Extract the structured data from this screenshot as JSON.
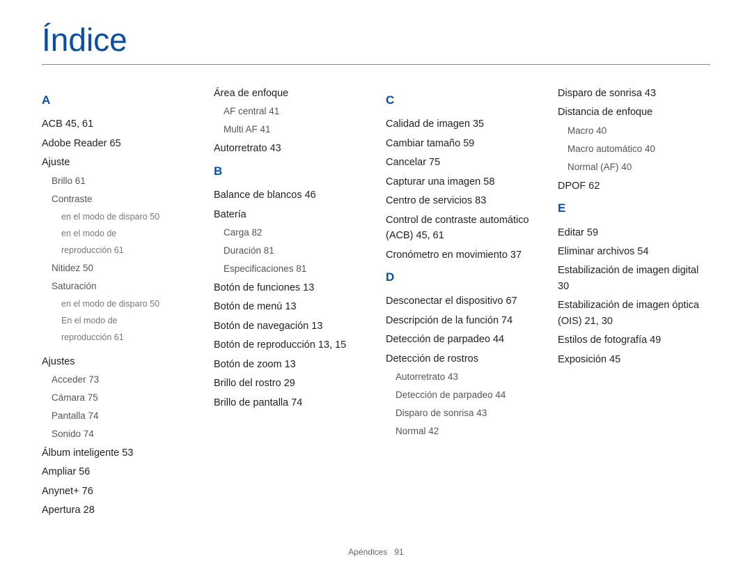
{
  "title": "Índice",
  "footer": {
    "section": "Apéndices",
    "page": "91"
  },
  "columns": [
    {
      "blocks": [
        {
          "type": "letter",
          "text": "A"
        },
        {
          "type": "entry",
          "text": "ACB  45, 61"
        },
        {
          "type": "entry",
          "text": "Adobe Reader  65"
        },
        {
          "type": "entry",
          "text": "Ajuste"
        },
        {
          "type": "sub",
          "text": "Brillo  61"
        },
        {
          "type": "sub",
          "text": "Contraste"
        },
        {
          "type": "sub2",
          "text": "en el modo de disparo  50"
        },
        {
          "type": "sub2",
          "text": "en el modo de"
        },
        {
          "type": "sub2",
          "text": "reproducción  61"
        },
        {
          "type": "sub",
          "text": "Nitidez  50"
        },
        {
          "type": "sub",
          "text": "Saturación"
        },
        {
          "type": "sub2",
          "text": "en el modo de disparo  50"
        },
        {
          "type": "sub2",
          "text": "En el modo de"
        },
        {
          "type": "sub2",
          "text": "reproducción  61"
        },
        {
          "type": "gap"
        },
        {
          "type": "entry",
          "text": "Ajustes"
        },
        {
          "type": "sub",
          "text": "Acceder  73"
        },
        {
          "type": "sub",
          "text": "Cámara  75"
        },
        {
          "type": "sub",
          "text": "Pantalla  74"
        },
        {
          "type": "sub",
          "text": "Sonido  74"
        },
        {
          "type": "entry",
          "text": "Álbum inteligente  53"
        },
        {
          "type": "entry",
          "text": "Ampliar  56"
        },
        {
          "type": "entry",
          "text": "Anynet+  76"
        },
        {
          "type": "entry",
          "text": "Apertura  28"
        }
      ]
    },
    {
      "blocks": [
        {
          "type": "entry",
          "text": "Área de enfoque"
        },
        {
          "type": "sub",
          "text": "AF central  41"
        },
        {
          "type": "sub",
          "text": "Multi AF  41"
        },
        {
          "type": "entry",
          "text": "Autorretrato  43"
        },
        {
          "type": "letter",
          "text": "B"
        },
        {
          "type": "entry",
          "text": "Balance de blancos  46"
        },
        {
          "type": "entry",
          "text": "Batería"
        },
        {
          "type": "sub",
          "text": "Carga  82"
        },
        {
          "type": "sub",
          "text": "Duración  81"
        },
        {
          "type": "sub",
          "text": "Especificaciones  81"
        },
        {
          "type": "entry",
          "text": "Botón de funciones  13"
        },
        {
          "type": "entry",
          "text": "Botón de menú  13"
        },
        {
          "type": "entry",
          "text": "Botón de navegación  13"
        },
        {
          "type": "entry",
          "text": "Botón de reproducción  13, 15"
        },
        {
          "type": "entry",
          "text": "Botón de zoom  13"
        },
        {
          "type": "entry",
          "text": "Brillo del rostro  29"
        },
        {
          "type": "entry",
          "text": "Brillo de pantalla  74"
        }
      ]
    },
    {
      "blocks": [
        {
          "type": "letter",
          "text": "C"
        },
        {
          "type": "entry",
          "text": "Calidad de imagen  35"
        },
        {
          "type": "entry",
          "text": "Cambiar tamaño  59"
        },
        {
          "type": "entry",
          "text": "Cancelar  75"
        },
        {
          "type": "entry",
          "text": "Capturar una imagen  58"
        },
        {
          "type": "entry",
          "text": "Centro de servicios  83"
        },
        {
          "type": "entry",
          "text": "Control de contraste automático (ACB)  45, 61"
        },
        {
          "type": "entry",
          "text": "Cronómetro en movimiento  37"
        },
        {
          "type": "letter",
          "text": "D"
        },
        {
          "type": "entry",
          "text": "Desconectar el dispositivo  67"
        },
        {
          "type": "entry",
          "text": "Descripción de la función  74"
        },
        {
          "type": "entry",
          "text": "Detección de parpadeo  44"
        },
        {
          "type": "entry",
          "text": "Detección de rostros"
        },
        {
          "type": "sub",
          "text": "Autorretrato  43"
        },
        {
          "type": "sub",
          "text": "Detección de parpadeo  44"
        },
        {
          "type": "sub",
          "text": "Disparo de sonrisa  43"
        },
        {
          "type": "sub",
          "text": "Normal  42"
        }
      ]
    },
    {
      "blocks": [
        {
          "type": "entry",
          "text": "Disparo de sonrisa  43"
        },
        {
          "type": "entry",
          "text": "Distancia de enfoque"
        },
        {
          "type": "sub",
          "text": "Macro  40"
        },
        {
          "type": "sub",
          "text": "Macro automático  40"
        },
        {
          "type": "sub",
          "text": "Normal (AF)  40"
        },
        {
          "type": "entry",
          "text": "DPOF  62"
        },
        {
          "type": "letter",
          "text": "E"
        },
        {
          "type": "entry",
          "text": "Editar  59"
        },
        {
          "type": "entry",
          "text": "Eliminar archivos  54"
        },
        {
          "type": "entry",
          "text": "Estabilización de imagen digital  30"
        },
        {
          "type": "entry",
          "text": "Estabilización de imagen óptica (OIS)  21, 30"
        },
        {
          "type": "entry",
          "text": "Estilos de fotografía  49"
        },
        {
          "type": "entry",
          "text": "Exposición  45"
        }
      ]
    }
  ]
}
